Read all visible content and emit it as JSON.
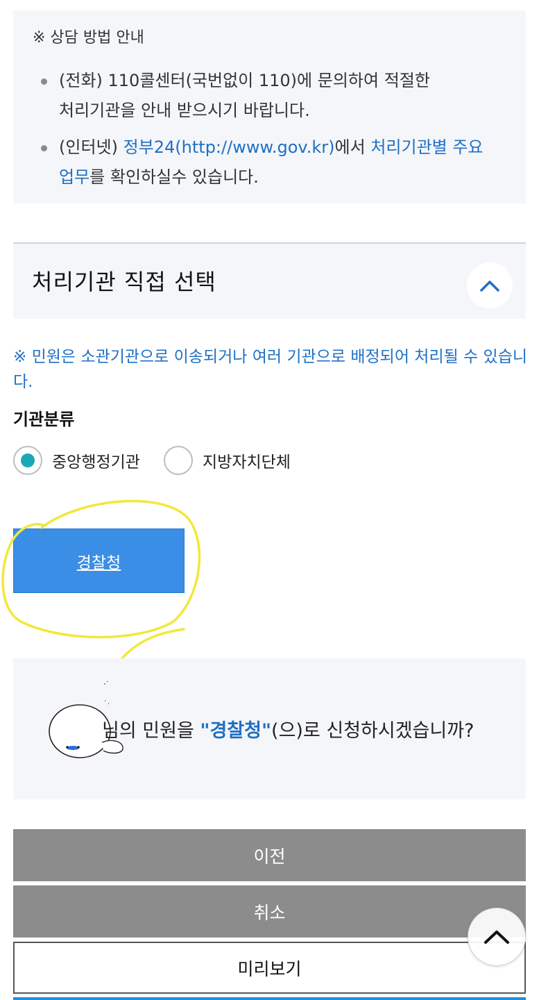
{
  "info": {
    "title": "※ 상담 방법 안내",
    "phone_line1": "(전화) 110콜센터(국번없이 110)에 문의하여 적절한",
    "phone_line2": "처리기관을 안내 받으시기 바랍니다.",
    "internet_prefix": "(인터넷) ",
    "internet_link1": "정부24(http://www.gov.kr)",
    "internet_mid": "에서 ",
    "internet_link2a": "처리기관별 주요",
    "internet_link2b": "업무",
    "internet_suffix": "를 확인하실수 있습니다."
  },
  "section": {
    "title": "처리기관 직접 선택",
    "toggle_icon": "chevron-up-icon"
  },
  "notice": "※ 민원은 소관기관으로 이송되거나 여러 기관으로 배정되어 처리될 수 있습니다.",
  "category": {
    "label": "기관분류",
    "options": [
      {
        "label": "중앙행정기관",
        "selected": true
      },
      {
        "label": "지방자치단체",
        "selected": false
      }
    ]
  },
  "agency_button": "경찰청",
  "confirm": {
    "prefix": "님의 민원을 ",
    "agency": "\"경찰청\"",
    "suffix": "(으)로 신청하시겠습니까?"
  },
  "buttons": {
    "prev": "이전",
    "cancel": "취소",
    "preview": "미리보기"
  },
  "colors": {
    "accent_blue": "#1f6fc5",
    "agency_button": "#3a8ee6",
    "radio_selected": "#1aa7b6",
    "gray_button": "#8c8c8c",
    "highlight_annotation": "#f2e83a"
  }
}
